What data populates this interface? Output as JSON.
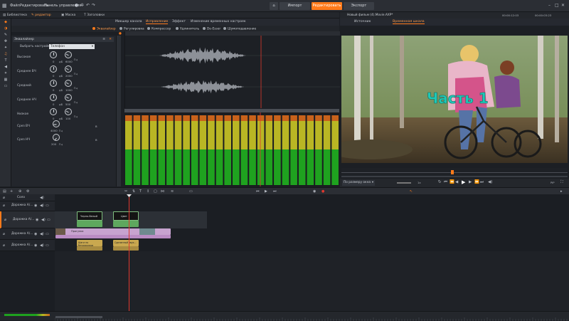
{
  "menu": {
    "file": "Файл",
    "edit": "Редактировать",
    "control_panel": "Панель управления"
  },
  "top_buttons": {
    "import": "Импорт",
    "edit": "Редактировать",
    "export": "Экспорт"
  },
  "library_tabs": {
    "library": "Библиотека",
    "editor": "редактор",
    "mask": "Маска",
    "titles": "Заголовки"
  },
  "effect_tabs": {
    "mix": "Микшер канала",
    "fix": "Исправление",
    "effect": "Эффект",
    "time": "Изменение временных настроек"
  },
  "sub_tabs": [
    "Эквалайзер",
    "Регулировка",
    "Компрессор",
    "Удлинитель",
    "De-Esser",
    "Шумоподавление"
  ],
  "equalizer": {
    "title": "Эквалайзер",
    "preset_label": "Выбрать настройку",
    "preset_value": "Телефон",
    "bands": [
      {
        "name": "Высокое",
        "db": "0",
        "db_unit": "дБ",
        "hz": "6000",
        "hz_unit": "Гц"
      },
      {
        "name": "Среднее ВЧ",
        "db": "0",
        "db_unit": "дБ",
        "hz": "2000",
        "hz_unit": "Гц"
      },
      {
        "name": "Средний",
        "db": "0",
        "db_unit": "дБ",
        "hz": "1000",
        "hz_unit": "Гц"
      },
      {
        "name": "Среднее НЧ",
        "db": "0",
        "db_unit": "дБ",
        "hz": "500",
        "hz_unit": "Гц"
      },
      {
        "name": "Низкое",
        "db": "0",
        "db_unit": "дБ",
        "hz": "100",
        "hz_unit": "Гц"
      }
    ],
    "cut_high": {
      "name": "Срез ВЧ",
      "hz": "4000",
      "hz_unit": "Гц"
    },
    "cut_low": {
      "name": "Срез НЧ",
      "hz": "200",
      "hz_unit": "Гц"
    }
  },
  "preview": {
    "title": "Новый фильм (4).Movie.AXP*",
    "timecode_left": "00:00:12:03",
    "timecode_right": "00:00:03:23",
    "tab_source": "Источник",
    "tab_timeline": "Временная шкала",
    "overlay_text": "Часть 1",
    "fit_label": "По размеру окна",
    "speed": "1x",
    "pip": "PiP"
  },
  "timeline": {
    "solo": "Соло",
    "tracks": [
      "Дорожка А/...",
      "Дорожка А/...",
      "Дорожка А/...",
      "Дорожка А/..."
    ],
    "clips": {
      "title_1": "Черно-белый",
      "title_2": "Цвет",
      "video_main": "Прогулка",
      "sound_1": "Шаги по бездорожью",
      "sound_2": "Сделанный звук..."
    }
  },
  "colors": {
    "accent": "#ff7a1a",
    "meter_green": "#1fa21f",
    "meter_yellow": "#b9b624",
    "meter_red": "#c8621b",
    "playhead": "#e0392f"
  }
}
